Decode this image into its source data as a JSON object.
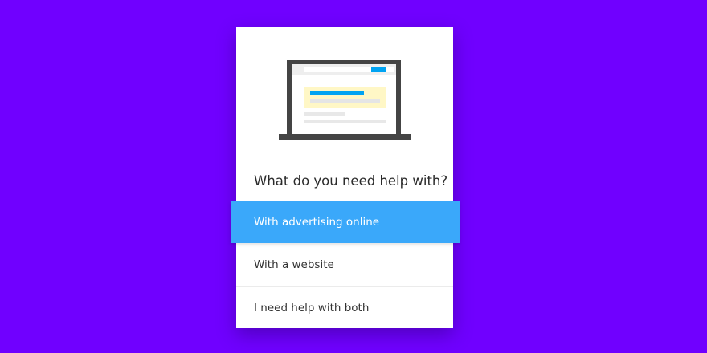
{
  "dialog": {
    "question": "What do you need help with?",
    "illustration_icon": "laptop-ad-icon",
    "options": [
      {
        "label": "With advertising online",
        "selected": true
      },
      {
        "label": "With a website",
        "selected": false
      },
      {
        "label": "I need help with both",
        "selected": false
      }
    ]
  },
  "colors": {
    "background": "#7000ff",
    "card": "#ffffff",
    "selected_option": "#3aa8fa",
    "text": "#2b2b2b",
    "laptop_frame": "#444444",
    "ad_highlight": "#fff7c6",
    "accent_bar": "#00a3f2"
  }
}
